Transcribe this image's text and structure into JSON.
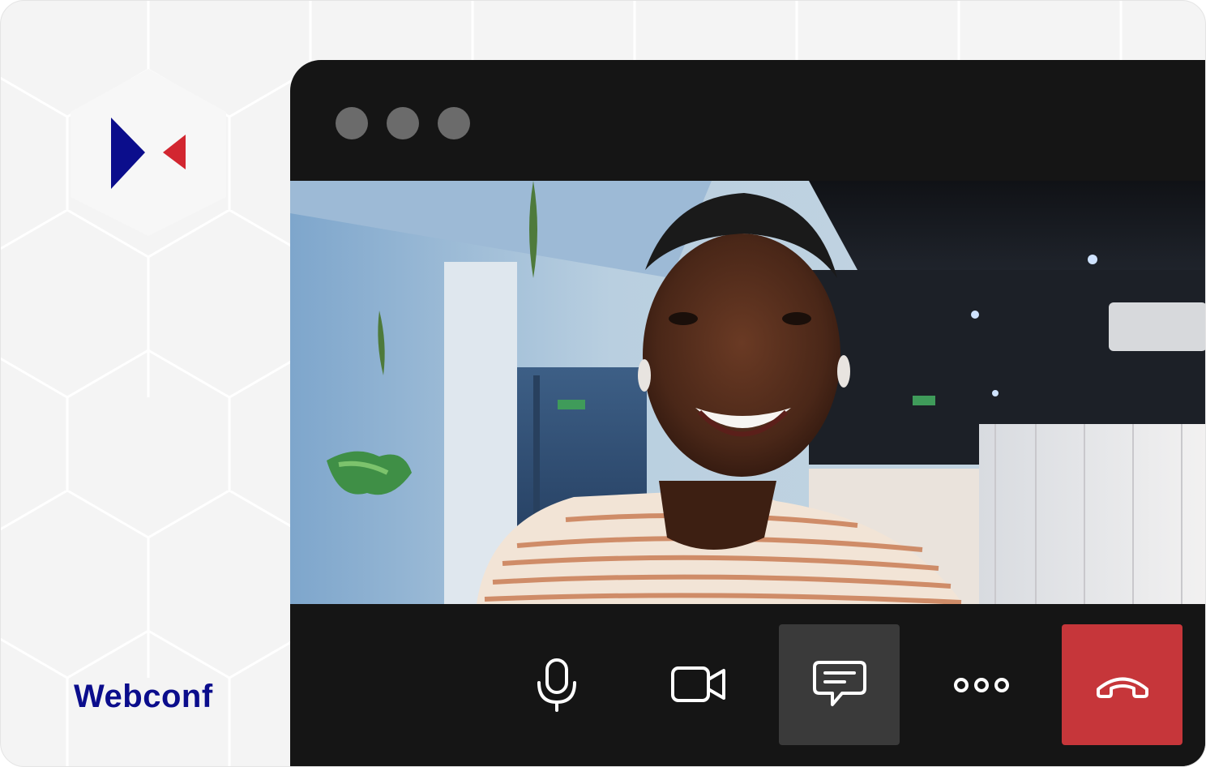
{
  "brand": {
    "name": "Webconf",
    "colors": {
      "primary": "#0b0d8c",
      "accent": "#d22630"
    }
  },
  "window": {
    "dots": [
      "window-dot",
      "window-dot",
      "window-dot"
    ]
  },
  "video": {
    "description_icon": "participant-video"
  },
  "controls": [
    {
      "icon": "microphone-icon",
      "state": "normal"
    },
    {
      "icon": "camera-icon",
      "state": "normal"
    },
    {
      "icon": "chat-icon",
      "state": "active"
    },
    {
      "icon": "more-options-icon",
      "state": "normal"
    },
    {
      "icon": "end-call-icon",
      "state": "danger",
      "color": "#c6363a"
    }
  ]
}
